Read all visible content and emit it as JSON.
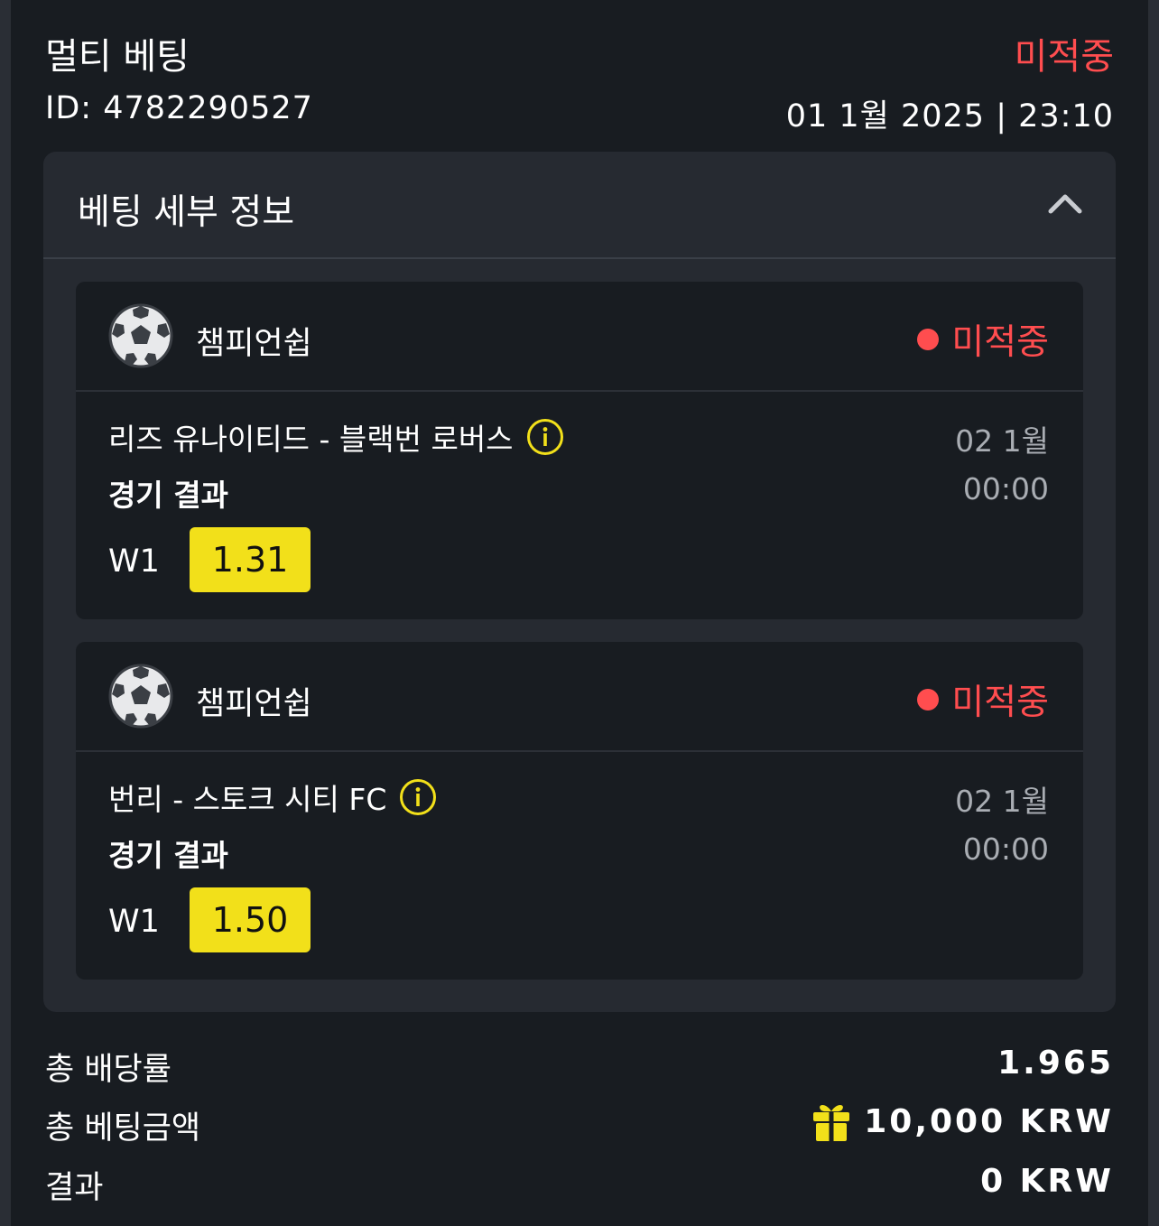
{
  "header": {
    "title": "멀티 베팅",
    "status": "미적중",
    "id_text": "ID: 4782290527",
    "datetime": "01 1월 2025 | 23:10"
  },
  "details": {
    "title": "베팅 세부 정보",
    "collapse_icon": "chevron-up-icon"
  },
  "events": [
    {
      "league": "챔피언쉽",
      "sport_icon": "soccer-ball-icon",
      "status": "미적중",
      "match": "리즈 유나이티드 - 블랙번 로버스",
      "market": "경기 결과",
      "date": "02 1월",
      "time": "00:00",
      "outcome": "W1",
      "odds": "1.31"
    },
    {
      "league": "챔피언쉽",
      "sport_icon": "soccer-ball-icon",
      "status": "미적중",
      "match": "번리 - 스토크 시티 FC",
      "market": "경기 결과",
      "date": "02 1월",
      "time": "00:00",
      "outcome": "W1",
      "odds": "1.50"
    }
  ],
  "summary": {
    "total_odds_label": "총 배당률",
    "total_odds_value": "1.965",
    "stake_label": "총 베팅금액",
    "stake_value": "10,000 KRW",
    "stake_icon": "gift-icon",
    "result_label": "결과",
    "result_value": "0 KRW"
  },
  "colors": {
    "lost": "#ff4d4f",
    "odds_bg": "#f2e01a",
    "card_bg": "#181c21",
    "panel_bg": "#262a31"
  }
}
